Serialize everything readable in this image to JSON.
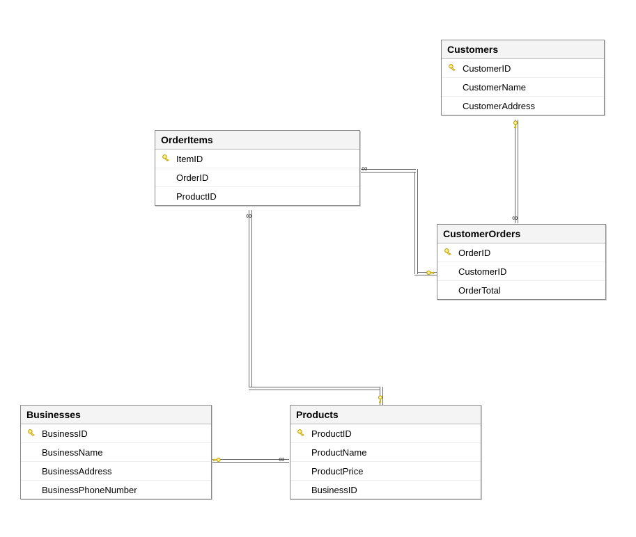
{
  "tables": {
    "customers": {
      "title": "Customers",
      "columns": [
        {
          "name": "CustomerID",
          "pk": true
        },
        {
          "name": "CustomerName",
          "pk": false
        },
        {
          "name": "CustomerAddress",
          "pk": false
        }
      ]
    },
    "orderItems": {
      "title": "OrderItems",
      "columns": [
        {
          "name": "ItemID",
          "pk": true
        },
        {
          "name": "OrderID",
          "pk": false
        },
        {
          "name": "ProductID",
          "pk": false
        }
      ]
    },
    "customerOrders": {
      "title": "CustomerOrders",
      "columns": [
        {
          "name": "OrderID",
          "pk": true
        },
        {
          "name": "CustomerID",
          "pk": false
        },
        {
          "name": "OrderTotal",
          "pk": false
        }
      ]
    },
    "businesses": {
      "title": "Businesses",
      "columns": [
        {
          "name": "BusinessID",
          "pk": true
        },
        {
          "name": "BusinessName",
          "pk": false
        },
        {
          "name": "BusinessAddress",
          "pk": false
        },
        {
          "name": "BusinessPhoneNumber",
          "pk": false
        }
      ]
    },
    "products": {
      "title": "Products",
      "columns": [
        {
          "name": "ProductID",
          "pk": true
        },
        {
          "name": "ProductName",
          "pk": false
        },
        {
          "name": "ProductPrice",
          "pk": false
        },
        {
          "name": "BusinessID",
          "pk": false
        }
      ]
    }
  },
  "relationships": [
    {
      "from": "Customers.CustomerID",
      "to": "CustomerOrders.CustomerID",
      "type": "one-to-many"
    },
    {
      "from": "CustomerOrders.OrderID",
      "to": "OrderItems.OrderID",
      "type": "one-to-many"
    },
    {
      "from": "Products.ProductID",
      "to": "OrderItems.ProductID",
      "type": "one-to-many"
    },
    {
      "from": "Businesses.BusinessID",
      "to": "Products.BusinessID",
      "type": "one-to-many"
    }
  ],
  "icons": {
    "primaryKey": "key-icon"
  }
}
